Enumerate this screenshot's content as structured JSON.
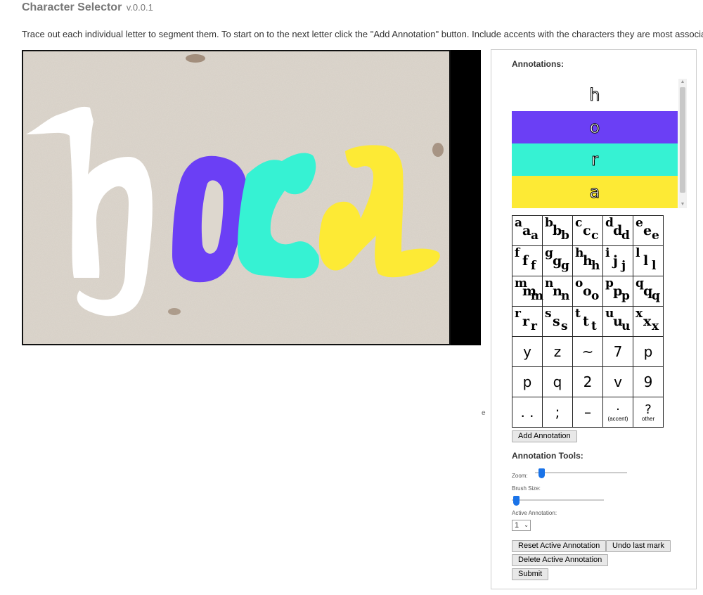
{
  "header": {
    "title": "Character Selector",
    "version": "v.0.0.1",
    "instructions": "Trace out each individual letter to segment them. To start on to the next letter click the \"Add Annotation\" button. Include accents with the characters they are most associated with."
  },
  "stray_text": "e",
  "annotations": {
    "heading": "Annotations:",
    "items": [
      {
        "label": "h",
        "color": "#ffffff"
      },
      {
        "label": "o",
        "color": "#6b3ff5"
      },
      {
        "label": "r",
        "color": "#36f2d3"
      },
      {
        "label": "a",
        "color": "#fdea35"
      }
    ]
  },
  "char_grid": {
    "rows": [
      [
        "aa",
        "bb",
        "cc",
        "dd",
        "ee"
      ],
      [
        "ff",
        "gg",
        "hh",
        "ij",
        "ll"
      ],
      [
        "mm",
        "nn",
        "oo",
        "pp",
        "qq"
      ],
      [
        "rr",
        "ss",
        "tt",
        "uu",
        "xx"
      ],
      [
        "y",
        "z",
        "~",
        "7",
        "p"
      ],
      [
        "p",
        "q",
        "2",
        "v",
        "9"
      ],
      [
        ". .",
        ";",
        "–",
        "(accent)",
        "other"
      ]
    ],
    "special": {
      "accent_sub": "(accent)",
      "other_main": "?",
      "other_sub": "other"
    }
  },
  "buttons": {
    "add_annotation": "Add Annotation",
    "reset_active": "Reset Active Annotation",
    "undo_last": "Undo last mark",
    "delete_active": "Delete Active Annotation",
    "submit": "Submit"
  },
  "tools": {
    "heading": "Annotation Tools:",
    "zoom_label": "Zoom:",
    "zoom_level": 0.04,
    "brush_label": "Brush Size:",
    "brush_level": 0.02,
    "active_label": "Active Annotation:",
    "active_value": "1"
  }
}
